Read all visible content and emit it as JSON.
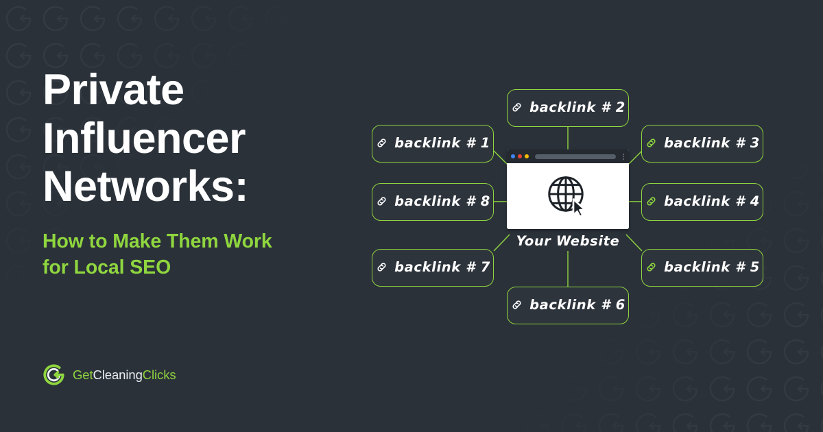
{
  "theme": {
    "background": "#2b3139",
    "accent_green": "#8fd63f",
    "node_fill": "#2e343c",
    "text_white": "#ffffff"
  },
  "headline": "Private\nInfluencer\nNetworks:",
  "subheadline": "How to Make Them Work\nfor Local SEO",
  "logo": {
    "mark_icon": "circular-g-arrow-icon",
    "text_part_1": "Get",
    "text_part_2": "Cleaning",
    "text_part_3": "Clicks",
    "full_text": "GetCleaningClicks"
  },
  "diagram": {
    "center": {
      "label": "Your Website",
      "window_icon": "browser-window-icon",
      "content_icon": "globe-cursor-icon",
      "traffic_light_colors": [
        "#4285f4",
        "#ea4335",
        "#fbbc05"
      ],
      "address_bar_placeholder": ""
    },
    "link_icon_name": "chain-link-icon",
    "nodes": [
      {
        "id": "n1",
        "label": "backlink # 1",
        "icon_color": "white"
      },
      {
        "id": "n2",
        "label": "backlink # 2",
        "icon_color": "white"
      },
      {
        "id": "n3",
        "label": "backlink # 3",
        "icon_color": "green"
      },
      {
        "id": "n4",
        "label": "backlink # 4",
        "icon_color": "green"
      },
      {
        "id": "n5",
        "label": "backlink # 5",
        "icon_color": "green"
      },
      {
        "id": "n6",
        "label": "backlink # 6",
        "icon_color": "white"
      },
      {
        "id": "n7",
        "label": "backlink # 7",
        "icon_color": "white"
      },
      {
        "id": "n8",
        "label": "backlink # 8",
        "icon_color": "white"
      }
    ]
  }
}
